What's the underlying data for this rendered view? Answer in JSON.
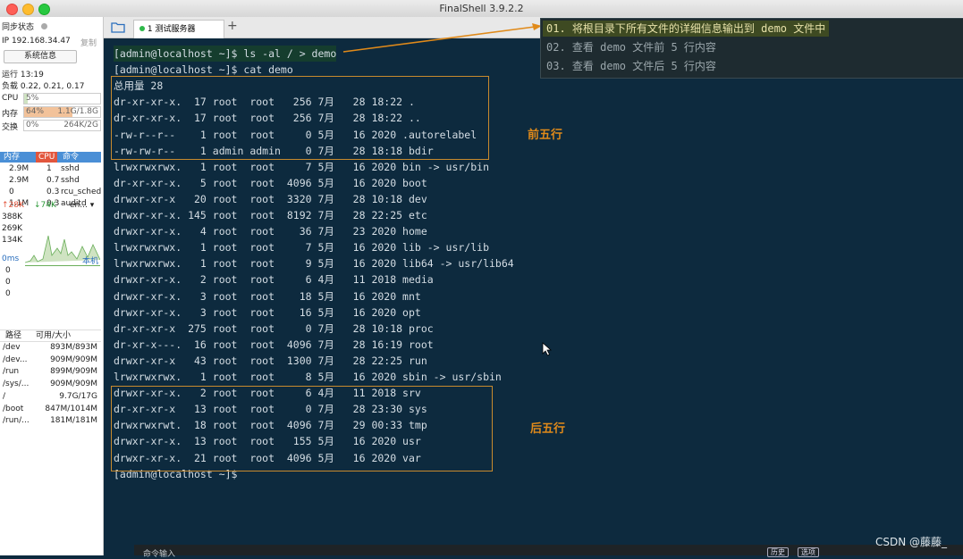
{
  "window": {
    "title": "FinalShell 3.9.2.2"
  },
  "sidebar": {
    "sync_label": "同步状态",
    "ip_label": "IP 192.168.34.47",
    "copy_label": "复制",
    "sysinfo_button": "系统信息",
    "uptime": "运行 13:19",
    "load": "负载 0.22, 0.21, 0.17",
    "cpu": {
      "label": "CPU",
      "value": "5%",
      "percent": 5
    },
    "mem": {
      "label": "内存",
      "percent_label": "64%",
      "value": "1.1G/1.8G",
      "percent": 64
    },
    "swap": {
      "label": "交换",
      "percent_label": "0%",
      "value": "264K/2G",
      "percent": 0
    },
    "proc_header": {
      "mem": "内存",
      "cpu": "CPU",
      "cmd": "命令"
    },
    "processes": [
      {
        "mem": "2.9M",
        "cpu": "1",
        "cmd": "sshd"
      },
      {
        "mem": "2.9M",
        "cpu": "0.7",
        "cmd": "sshd"
      },
      {
        "mem": "0",
        "cpu": "0.3",
        "cmd": "rcu_sched"
      },
      {
        "mem": "1.1M",
        "cpu": "0.3",
        "cmd": "auditd"
      }
    ],
    "net": {
      "up": "↑28K",
      "down": "↓74K",
      "iface": "en...",
      "scale": [
        "388K",
        "269K",
        "134K"
      ]
    },
    "ping": {
      "latency": "0ms",
      "host": "本机",
      "rows": [
        "0",
        "0",
        "0"
      ]
    },
    "disk_header": {
      "path": "路径",
      "size": "可用/大小"
    },
    "disks": [
      {
        "path": "/dev",
        "size": "893M/893M"
      },
      {
        "path": "/dev...",
        "size": "909M/909M"
      },
      {
        "path": "/run",
        "size": "899M/909M"
      },
      {
        "path": "/sys/...",
        "size": "909M/909M"
      },
      {
        "path": "/",
        "size": "9.7G/17G"
      },
      {
        "path": "/boot",
        "size": "847M/1014M"
      },
      {
        "path": "/run/...",
        "size": "181M/181M"
      }
    ]
  },
  "tabs": [
    {
      "label": "1 测试服务器"
    }
  ],
  "add_tab": "+",
  "terminal": {
    "lines": [
      "[admin@localhost ~]$ ls -al / > demo",
      "[admin@localhost ~]$ cat demo",
      "总用量 28",
      "dr-xr-xr-x.  17 root  root   256 7月   28 18:22 .",
      "dr-xr-xr-x.  17 root  root   256 7月   28 18:22 ..",
      "-rw-r--r--    1 root  root     0 5月   16 2020 .autorelabel",
      "-rw-rw-r--    1 admin admin    0 7月   28 18:18 bdir",
      "lrwxrwxrwx.   1 root  root     7 5月   16 2020 bin -> usr/bin",
      "dr-xr-xr-x.   5 root  root  4096 5月   16 2020 boot",
      "drwxr-xr-x   20 root  root  3320 7月   28 10:18 dev",
      "drwxr-xr-x. 145 root  root  8192 7月   28 22:25 etc",
      "drwxr-xr-x.   4 root  root    36 7月   23 2020 home",
      "lrwxrwxrwx.   1 root  root     7 5月   16 2020 lib -> usr/lib",
      "lrwxrwxrwx.   1 root  root     9 5月   16 2020 lib64 -> usr/lib64",
      "drwxr-xr-x.   2 root  root     6 4月   11 2018 media",
      "drwxr-xr-x.   3 root  root    18 5月   16 2020 mnt",
      "drwxr-xr-x.   3 root  root    16 5月   16 2020 opt",
      "dr-xr-xr-x  275 root  root     0 7月   28 10:18 proc",
      "dr-xr-x---.  16 root  root  4096 7月   28 16:19 root",
      "drwxr-xr-x   43 root  root  1300 7月   28 22:25 run",
      "lrwxrwxrwx.   1 root  root     8 5月   16 2020 sbin -> usr/sbin",
      "drwxr-xr-x.   2 root  root     6 4月   11 2018 srv",
      "dr-xr-xr-x   13 root  root     0 7月   28 23:30 sys",
      "drwxrwxrwt.  18 root  root  4096 7月   29 00:33 tmp",
      "drwxr-xr-x.  13 root  root   155 5月   16 2020 usr",
      "drwxr-xr-x.  21 root  root  4096 5月   16 2020 var",
      "[admin@localhost ~]$"
    ],
    "annotation_top": "前五行",
    "annotation_bottom": "后五行"
  },
  "hints": [
    "01. 将根目录下所有文件的详细信息输出到 demo 文件中",
    "02. 查看 demo 文件前 5 行内容",
    "03. 查看 demo 文件后 5 行内容"
  ],
  "statusbar": {
    "cmd_input": "命令输入",
    "history": "历史",
    "options": "选项"
  },
  "watermark": "CSDN @藤藤_",
  "colors": {
    "terminal_bg": "#0d2a3e",
    "annotation": "#e08a1a",
    "box": "#c88a2e",
    "mem_bar": "#f2c29a"
  }
}
